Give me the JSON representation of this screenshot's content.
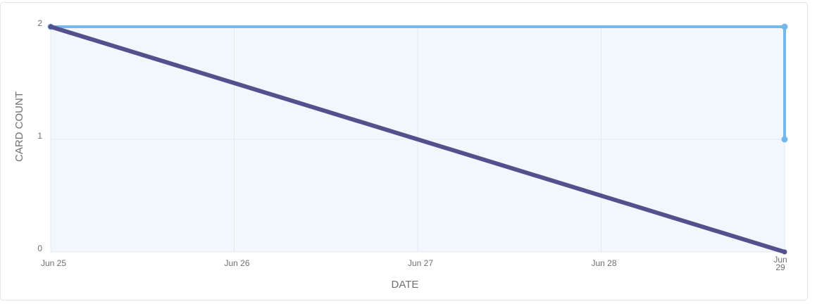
{
  "chart_data": {
    "type": "line",
    "title": "",
    "xlabel": "DATE",
    "ylabel": "CARD COUNT",
    "x": [
      "Jun 25",
      "Jun 26",
      "Jun 27",
      "Jun 28",
      "Jun 29"
    ],
    "x_ticks": [
      "Jun 25",
      "Jun 26",
      "Jun 27",
      "Jun 28",
      "Jun 29"
    ],
    "y_ticks": [
      "0",
      "1",
      "2"
    ],
    "ylim": [
      0,
      2
    ],
    "grid": true,
    "legend": "none",
    "series": [
      {
        "color": "#74b7ea",
        "area_fill": "#f1f7fc",
        "points": [
          {
            "x": "Jun 25",
            "y": 2
          },
          {
            "x": "Jun 29",
            "y": 2
          },
          {
            "x": "Jun 29",
            "y": 1
          }
        ]
      },
      {
        "color": "#54508e",
        "points": [
          {
            "x": "Jun 25",
            "y": 2
          },
          {
            "x": "Jun 29",
            "y": 0
          }
        ]
      }
    ]
  }
}
